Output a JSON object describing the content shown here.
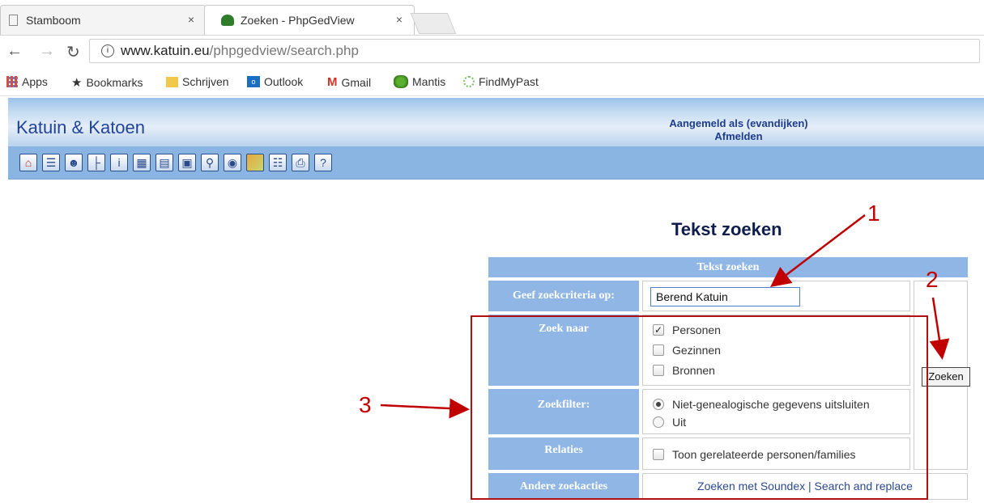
{
  "browser": {
    "tabs": [
      {
        "title": "Stamboom",
        "close": "×"
      },
      {
        "title": "Zoeken - PhpGedView",
        "close": "×"
      }
    ],
    "url": {
      "host": "www.katuin.eu",
      "path": "/phpgedview/search.php"
    },
    "bookmarks": [
      "Apps",
      "Bookmarks",
      "Schrijven",
      "Outlook",
      "Gmail",
      "Mantis",
      "FindMyPast"
    ]
  },
  "site": {
    "title": "Katuin & Katoen",
    "login_text": "Aangemeld als (evandijken)",
    "logout_text": "Afmelden"
  },
  "toolbar_icons": [
    "home-icon",
    "list-icon",
    "person-icon",
    "pedigree-icon",
    "individual-icon",
    "calendar-icon",
    "report-icon",
    "save-icon",
    "search-icon",
    "media-icon",
    "map-icon",
    "book-icon",
    "print-icon",
    "help-icon"
  ],
  "page": {
    "heading": "Tekst zoeken"
  },
  "search": {
    "table_header": "Tekst zoeken",
    "criteria_label": "Geef zoekcriteria op:",
    "criteria_value": "Berend Katuin",
    "search_for_label": "Zoek naar",
    "search_for_options": [
      {
        "label": "Personen",
        "checked": true
      },
      {
        "label": "Gezinnen",
        "checked": false
      },
      {
        "label": "Bronnen",
        "checked": false
      }
    ],
    "filter_label": "Zoekfilter:",
    "filter_options": [
      {
        "label": "Niet-genealogische gegevens uitsluiten",
        "selected": true
      },
      {
        "label": "Uit",
        "selected": false
      }
    ],
    "relations_label": "Relaties",
    "relations_option": "Toon gerelateerde personen/families",
    "other_label": "Andere zoekacties",
    "soundex_link": "Zoeken met Soundex",
    "separator": "|",
    "replace_link": "Search and replace",
    "button_label": "Zoeken"
  },
  "annotations": {
    "one": "1",
    "two": "2",
    "three": "3"
  },
  "colors": {
    "annotation": "#c00000",
    "header_blue": "#8fb6e4",
    "title_blue": "#21449a"
  }
}
